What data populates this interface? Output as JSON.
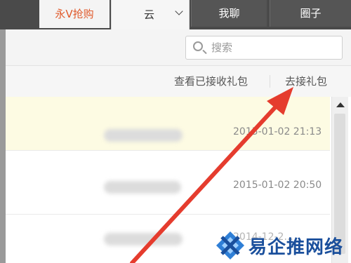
{
  "header": {
    "promo_label": "永V抢购",
    "tabs": [
      {
        "label": "云"
      },
      {
        "label": "我聊"
      },
      {
        "label": "圈子"
      }
    ]
  },
  "search": {
    "placeholder": "搜索"
  },
  "links": {
    "view_received": "查看已接收礼包",
    "go_receive": "去接礼包"
  },
  "list": {
    "items": [
      {
        "name_obscured": true,
        "time": "2015-01-02 21:13"
      },
      {
        "name_obscured": true,
        "time": "2015-01-02 20:50"
      },
      {
        "name_obscured": true,
        "time": "2014-12-2..."
      }
    ]
  },
  "watermark": {
    "text": "易企推网络"
  },
  "colors": {
    "topbar": "#4a4a4a",
    "promo_text": "#e0592a",
    "highlight_row": "#fdfbe3",
    "arrow": "#e53c2e",
    "watermark": "#1a4f9c"
  }
}
